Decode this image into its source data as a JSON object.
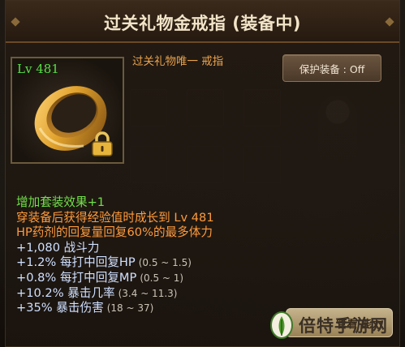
{
  "window": {
    "title": "过关礼物金戒指 (装备中)"
  },
  "item": {
    "level": "Lv 481",
    "subtitle": "过关礼物唯一 戒指",
    "icon": "gold-ring-icon",
    "locked": true,
    "ring_color": "#e0a12c"
  },
  "protect": {
    "label": "保护装备 : Off"
  },
  "stats": {
    "set_bonus": "增加套装效果+1",
    "desc_1": "穿装备后获得经验值时成长到 Lv 481",
    "desc_2": "HP药剂的回复量回复60%的最多体力",
    "lines": [
      {
        "text": "+1,080 战斗力",
        "range": ""
      },
      {
        "text": "+1.2% 每打中回复HP",
        "range": "(0.5 ~ 1.5)"
      },
      {
        "text": "+0.8% 每打中回复MP",
        "range": "(0.5 ~ 1)"
      },
      {
        "text": "+10.2% 暴击几率",
        "range": "(3.4 ~ 11.3)"
      },
      {
        "text": "+35% 暴击伤害",
        "range": "(18 ~ 37)"
      }
    ]
  },
  "bottom_button": {
    "label": "管看 能力"
  },
  "watermark": {
    "text": "倍特手游网"
  },
  "colors": {
    "set_bonus": "#72e04a",
    "description": "#ff9a3c",
    "stat": "#cfe0ff",
    "level": "#56e045",
    "subtitle": "#e9a24b"
  }
}
